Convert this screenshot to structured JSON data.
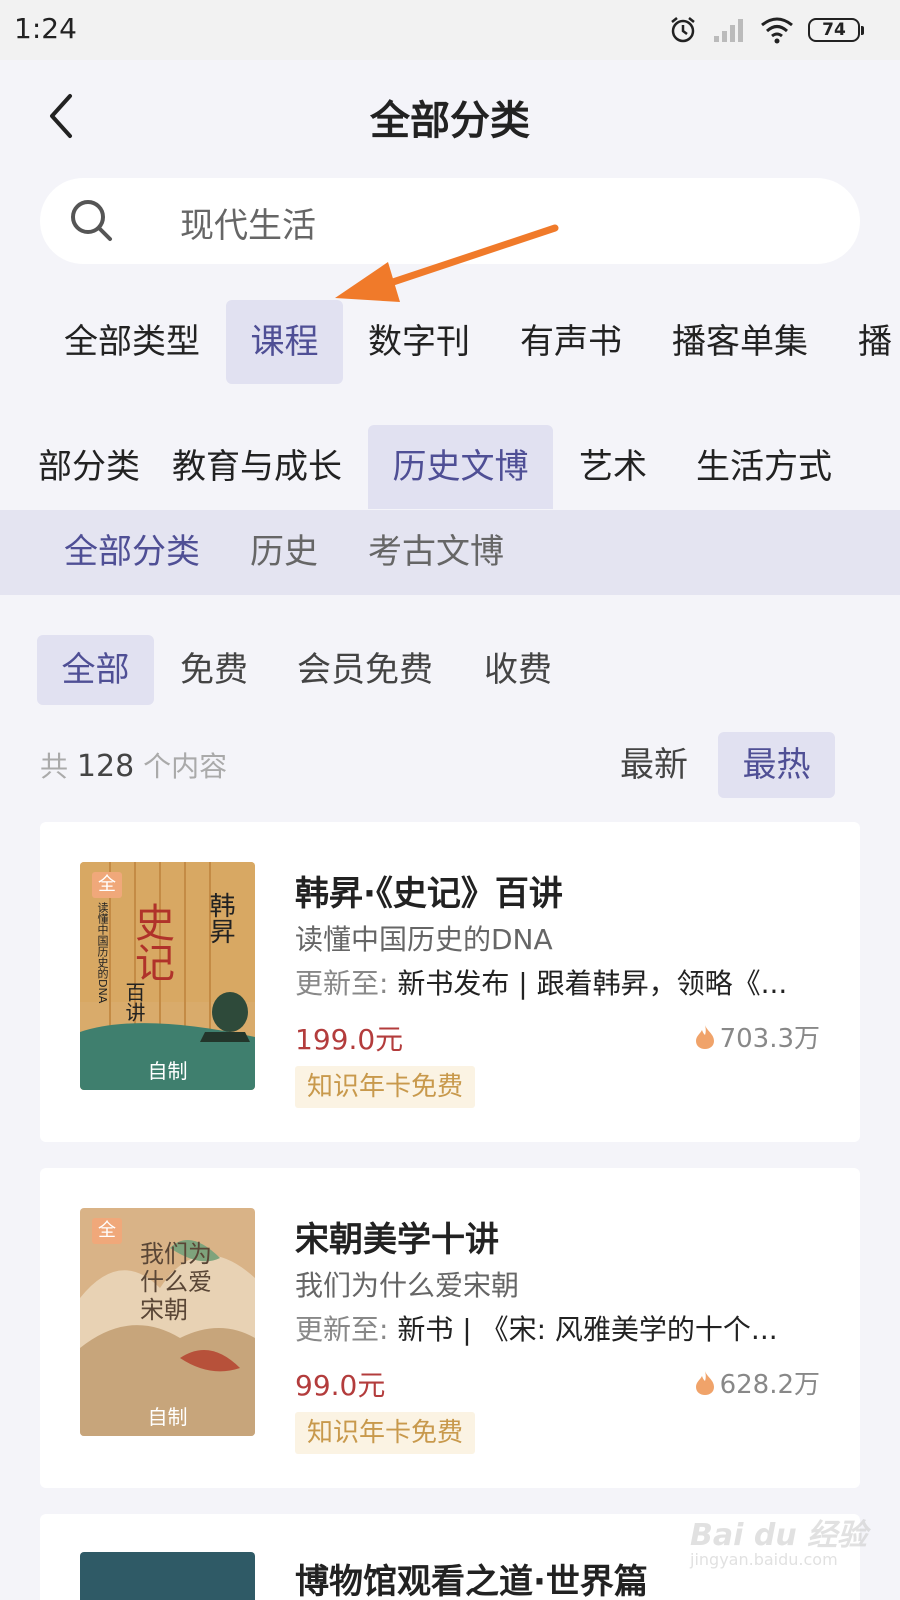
{
  "status_bar": {
    "time": "1:24",
    "battery": "74",
    "icons": [
      "alarm-icon",
      "signal-icon",
      "wifi-icon",
      "battery-icon"
    ]
  },
  "header": {
    "title": "全部分类"
  },
  "search": {
    "placeholder": "现代生活"
  },
  "type_tabs": {
    "items": [
      {
        "label": "全部类型",
        "active": false
      },
      {
        "label": "课程",
        "active": true
      },
      {
        "label": "数字刊",
        "active": false
      },
      {
        "label": "有声书",
        "active": false
      },
      {
        "label": "播客单集",
        "active": false
      },
      {
        "label": "播",
        "active": false
      }
    ]
  },
  "category_tabs": {
    "items": [
      {
        "label": "部分类",
        "active": false
      },
      {
        "label": "教育与成长",
        "active": false
      },
      {
        "label": "历史文博",
        "active": true
      },
      {
        "label": "艺术",
        "active": false
      },
      {
        "label": "生活方式",
        "active": false
      }
    ]
  },
  "subcategory_tabs": {
    "items": [
      {
        "label": "全部分类",
        "active": true
      },
      {
        "label": "历史",
        "active": false
      },
      {
        "label": "考古文博",
        "active": false
      }
    ]
  },
  "price_filter": {
    "items": [
      {
        "label": "全部",
        "active": true
      },
      {
        "label": "免费",
        "active": false
      },
      {
        "label": "会员免费",
        "active": false
      },
      {
        "label": "收费",
        "active": false
      }
    ]
  },
  "results": {
    "prefix": "共",
    "count": "128",
    "suffix": "个内容"
  },
  "sort": {
    "items": [
      {
        "label": "最新",
        "active": false
      },
      {
        "label": "最热",
        "active": true
      }
    ]
  },
  "cards": [
    {
      "title": "韩昇·《史记》百讲",
      "subtitle": "读懂中国历史的DNA",
      "update_label": "更新至:",
      "update_text": "新书发布 | 跟着韩昇，领略《...",
      "price": "199.0元",
      "heat": "703.3万",
      "tag": "知识年卡免费",
      "cover_badge": "全",
      "cover_label": "自制",
      "cover_title": "史记",
      "cover_side_text": "韩昇",
      "cover_subtitle": "百讲",
      "cover_vertical": "读懂中国历史的DNA"
    },
    {
      "title": "宋朝美学十讲",
      "subtitle": "我们为什么爱宋朝",
      "update_label": "更新至:",
      "update_text": "新书 | 《宋: 风雅美学的十个...",
      "price": "99.0元",
      "heat": "628.2万",
      "tag": "知识年卡免费",
      "cover_badge": "全",
      "cover_label": "自制",
      "cover_title": "我们为什么爱宋朝"
    },
    {
      "title": "博物馆观看之道·世界篇"
    }
  ],
  "watermark": {
    "text": "Bai du 经验",
    "url": "jingyan.baidu.com"
  },
  "colors": {
    "accent": "#4f4f95",
    "active_bg": "#e1e1f1",
    "price": "#b33c3c",
    "tag_bg": "#fbf3e3",
    "tag_text": "#c8994c",
    "annotation_arrow": "#f07a2a"
  }
}
